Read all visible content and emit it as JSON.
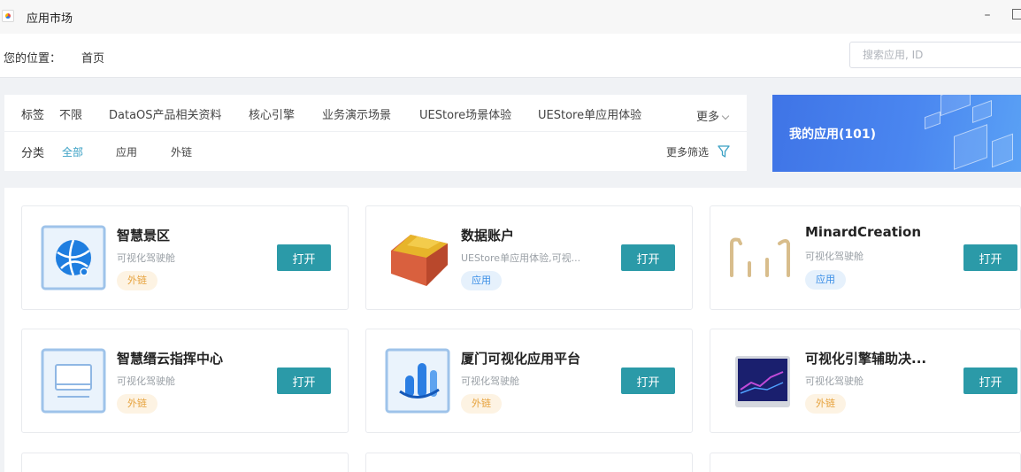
{
  "window": {
    "title": "应用市场",
    "minimize": "–"
  },
  "location": {
    "label": "您的位置：",
    "crumb": "首页"
  },
  "search": {
    "placeholder": "搜索应用, ID"
  },
  "filters": {
    "tag_key": "标签",
    "tags": [
      "不限",
      "DataOS产品相关资料",
      "核心引擎",
      "业务演示场景",
      "UEStore场景体验",
      "UEStore单应用体验"
    ],
    "more": "更多",
    "category_key": "分类",
    "categories": [
      "全部",
      "应用",
      "外链"
    ],
    "more_filters": "更多筛选"
  },
  "my_apps": {
    "label": "我的应用(101)"
  },
  "open_label": "打开",
  "cards": [
    {
      "name": "智慧景区",
      "desc": "可视化驾驶舱",
      "tag": "外链",
      "tag_type": "ext",
      "icon": "globe-icon"
    },
    {
      "name": "数据账户",
      "desc": "UEStore单应用体验,可视...",
      "tag": "应用",
      "tag_type": "app",
      "icon": "cube-icon"
    },
    {
      "name": "MinardCreation",
      "desc": "可视化驾驶舱",
      "tag": "应用",
      "tag_type": "app",
      "icon": "bars-icon"
    },
    {
      "name": "智慧缙云指挥中心",
      "desc": "可视化驾驶舱",
      "tag": "外链",
      "tag_type": "ext",
      "icon": "monitor-icon"
    },
    {
      "name": "厦门可视化应用平台",
      "desc": "可视化驾驶舱",
      "tag": "外链",
      "tag_type": "ext",
      "icon": "chart-bars-icon"
    },
    {
      "name": "可视化引擎辅助决...",
      "desc": "可视化驾驶舱",
      "tag": "外链",
      "tag_type": "ext",
      "icon": "trend-screen-icon"
    }
  ],
  "colors": {
    "accent": "#2b9aa8",
    "active_filter": "#3aa0c4",
    "banner": "#4a86f0",
    "ext_tag": "#e6a23c",
    "app_tag": "#3a8ee6"
  }
}
